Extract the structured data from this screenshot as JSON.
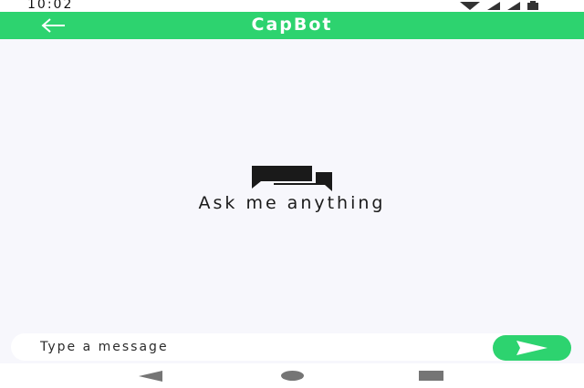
{
  "status_bar": {
    "time": "10:02",
    "icons": [
      "wifi-icon",
      "signal-icon",
      "signal-icon",
      "battery-icon"
    ]
  },
  "app_bar": {
    "title": "CapBot",
    "back_icon": "arrow-left-icon"
  },
  "empty_state": {
    "icon": "chat-bubbles-icon",
    "text": "Ask me anything"
  },
  "composer": {
    "placeholder": "Type a message",
    "value": "",
    "send_icon": "send-icon"
  },
  "nav_bar": {
    "icons": [
      "nav-back-icon",
      "nav-home-icon",
      "nav-recents-icon"
    ]
  },
  "colors": {
    "accent": "#2dd36f",
    "background": "#f7f7fc",
    "nav_icon": "#757575"
  }
}
